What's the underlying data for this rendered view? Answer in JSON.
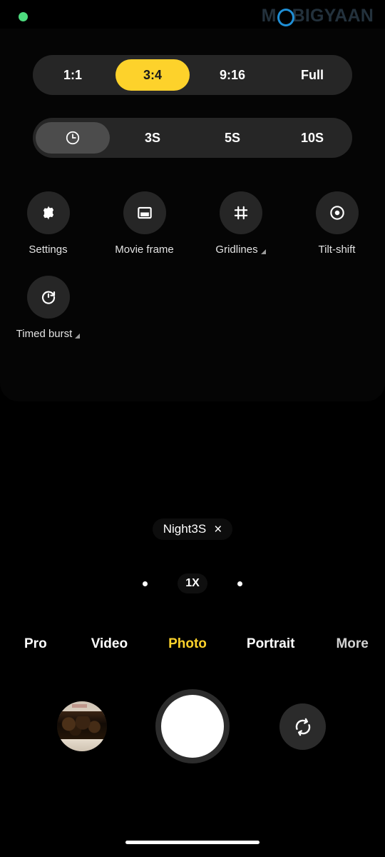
{
  "status": {
    "recording_indicator": "green-dot"
  },
  "watermark": {
    "pre": "M",
    "circle": "O",
    "post": "BIGYAAN",
    "color": "#23313c",
    "accent": "#1f8fd6"
  },
  "panel": {
    "aspect_ratio": {
      "options": [
        {
          "label": "1:1",
          "selected": false
        },
        {
          "label": "3:4",
          "selected": true
        },
        {
          "label": "9:16",
          "selected": false
        },
        {
          "label": "Full",
          "selected": false
        }
      ],
      "accent": "#fdd22b"
    },
    "timer": {
      "options": [
        {
          "label": "",
          "icon": "clock-icon",
          "selected": true
        },
        {
          "label": "3S",
          "selected": false
        },
        {
          "label": "5S",
          "selected": false
        },
        {
          "label": "10S",
          "selected": false
        }
      ]
    },
    "tools": [
      {
        "label": "Settings",
        "icon": "gear-icon",
        "expandable": false
      },
      {
        "label": "Movie frame",
        "icon": "movie-frame-icon",
        "expandable": false
      },
      {
        "label": "Gridlines",
        "icon": "gridlines-icon",
        "expandable": true
      },
      {
        "label": "Tilt-shift",
        "icon": "tilt-shift-icon",
        "expandable": false
      },
      {
        "label": "Timed burst",
        "icon": "timed-burst-icon",
        "expandable": true
      }
    ]
  },
  "viewfinder": {
    "active_mode_chip": {
      "text": "Night3S",
      "close": "×"
    },
    "zoom": {
      "value": "1X",
      "left_dot": "•",
      "right_dot": "•"
    }
  },
  "mode_tabs": [
    {
      "label": "Pro",
      "state": "normal"
    },
    {
      "label": "Video",
      "state": "normal"
    },
    {
      "label": "Photo",
      "state": "active"
    },
    {
      "label": "Portrait",
      "state": "normal"
    },
    {
      "label": "More",
      "state": "dim"
    }
  ],
  "bottom_bar": {
    "gallery_thumbnail": "gallery-thumbnail",
    "shutter": "shutter-button",
    "flip": "flip-camera-icon"
  }
}
